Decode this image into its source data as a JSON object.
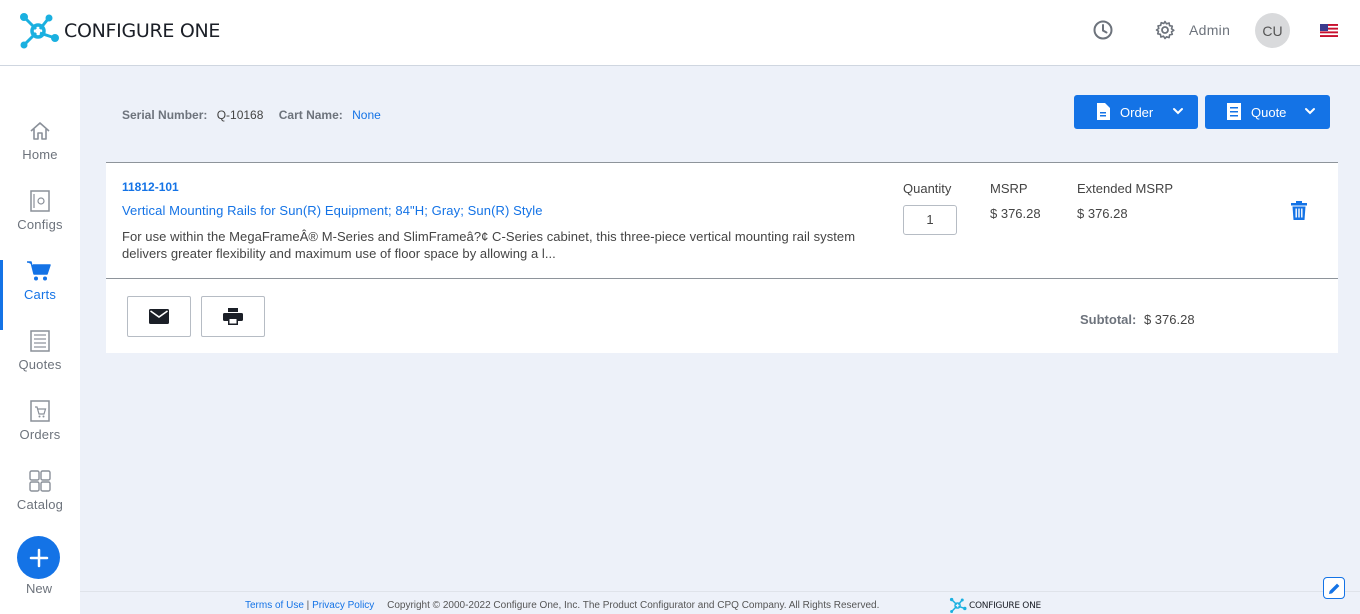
{
  "header": {
    "brand": "CONFIGURE ONE",
    "user_label": "Admin",
    "avatar_initials": "CU",
    "icons": [
      "history-icon",
      "settings-gear-icon",
      "us-flag-icon"
    ]
  },
  "sidebar": {
    "items": [
      {
        "label": "Home",
        "icon": "home-icon",
        "active": false
      },
      {
        "label": "Configs",
        "icon": "configs-icon",
        "active": false
      },
      {
        "label": "Carts",
        "icon": "cart-icon",
        "active": true
      },
      {
        "label": "Quotes",
        "icon": "quotes-icon",
        "active": false
      },
      {
        "label": "Orders",
        "icon": "orders-icon",
        "active": false
      },
      {
        "label": "Catalog",
        "icon": "catalog-icon",
        "active": false
      }
    ],
    "new_label": "New"
  },
  "cart": {
    "serial_label": "Serial Number:",
    "serial_value": "Q-10168",
    "name_label": "Cart Name:",
    "name_value": "None",
    "order_button": "Order",
    "quote_button": "Quote"
  },
  "line_item": {
    "sku": "11812-101",
    "title": "Vertical Mounting Rails for Sun(R) Equipment; 84\"H; Gray; Sun(R) Style",
    "description": "For use within the MegaFrameÂ® M-Series and SlimFrameâ?¢ C-Series cabinet, this three-piece vertical mounting rail system delivers greater flexibility and maximum use of floor space by allowing a l...",
    "quantity_label": "Quantity",
    "quantity": "1",
    "msrp_label": "MSRP",
    "msrp": "$ 376.28",
    "ext_msrp_label": "Extended MSRP",
    "ext_msrp": "$ 376.28"
  },
  "totals": {
    "subtotal_label": "Subtotal:",
    "subtotal_value": "$ 376.28"
  },
  "footer": {
    "terms": "Terms of Use",
    "separator": " | ",
    "privacy": "Privacy Policy",
    "copyright": "Copyright © 2000-2022 Configure One, Inc. The Product Configurator and CPQ Company. All Rights Reserved.",
    "brand": "CONFIGURE ONE"
  },
  "colors": {
    "accent": "#1473e6",
    "logo": "#1ab0e0",
    "background": "#edf1f9"
  }
}
